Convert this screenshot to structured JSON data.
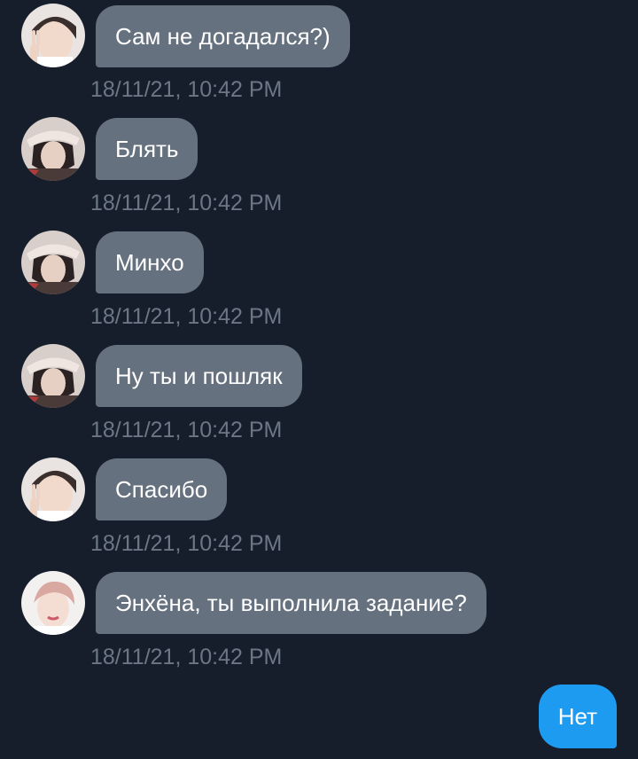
{
  "messages": [
    {
      "sender_avatar": "avatar-peace-sign",
      "text": "Сам не догадался?)",
      "time": "18/11/21, 10:42 PM"
    },
    {
      "sender_avatar": "avatar-dark-hat",
      "text": "Блять",
      "time": "18/11/21, 10:42 PM"
    },
    {
      "sender_avatar": "avatar-dark-hat",
      "text": "Минхо",
      "time": "18/11/21, 10:42 PM"
    },
    {
      "sender_avatar": "avatar-dark-hat",
      "text": "Ну ты и пошляк",
      "time": "18/11/21, 10:42 PM"
    },
    {
      "sender_avatar": "avatar-peace-sign",
      "text": "Спасибо",
      "time": "18/11/21, 10:42 PM"
    },
    {
      "sender_avatar": "avatar-light-hair",
      "text": "Энхёна, ты выполнила задание?",
      "time": "18/11/21, 10:42 PM"
    }
  ],
  "outgoing": {
    "text": "Нет"
  },
  "colors": {
    "background": "#161e2c",
    "incoming_bubble": "#66717f",
    "outgoing_bubble": "#1d9bf0",
    "timestamp": "#6b7785",
    "text": "#ffffff"
  }
}
